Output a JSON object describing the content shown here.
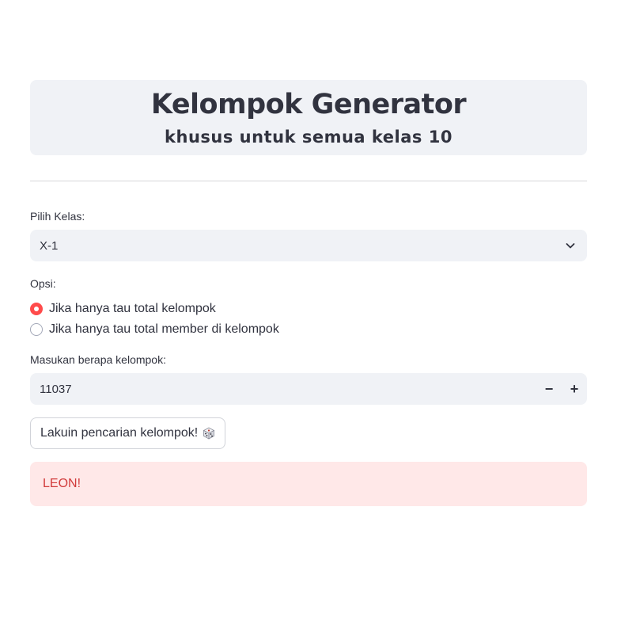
{
  "header": {
    "title": "Kelompok Generator",
    "subtitle": "khusus untuk semua kelas 10"
  },
  "class_select": {
    "label": "Pilih Kelas:",
    "value": "X-1"
  },
  "options": {
    "label": "Opsi:",
    "items": [
      {
        "label": "Jika hanya tau total kelompok",
        "selected": true
      },
      {
        "label": "Jika hanya tau total member di kelompok",
        "selected": false
      }
    ]
  },
  "group_count": {
    "label": "Masukan berapa kelompok:",
    "value": "11037",
    "decrement": "−",
    "increment": "+"
  },
  "action": {
    "label": "Lakuin pencarian kelompok!",
    "icon": "dice-icon"
  },
  "alert": {
    "text": "LEON!",
    "color": "#d13b3b",
    "background": "#ffe8e8"
  },
  "colors": {
    "accent": "#ff4b4b",
    "panel": "#f0f2f6"
  }
}
